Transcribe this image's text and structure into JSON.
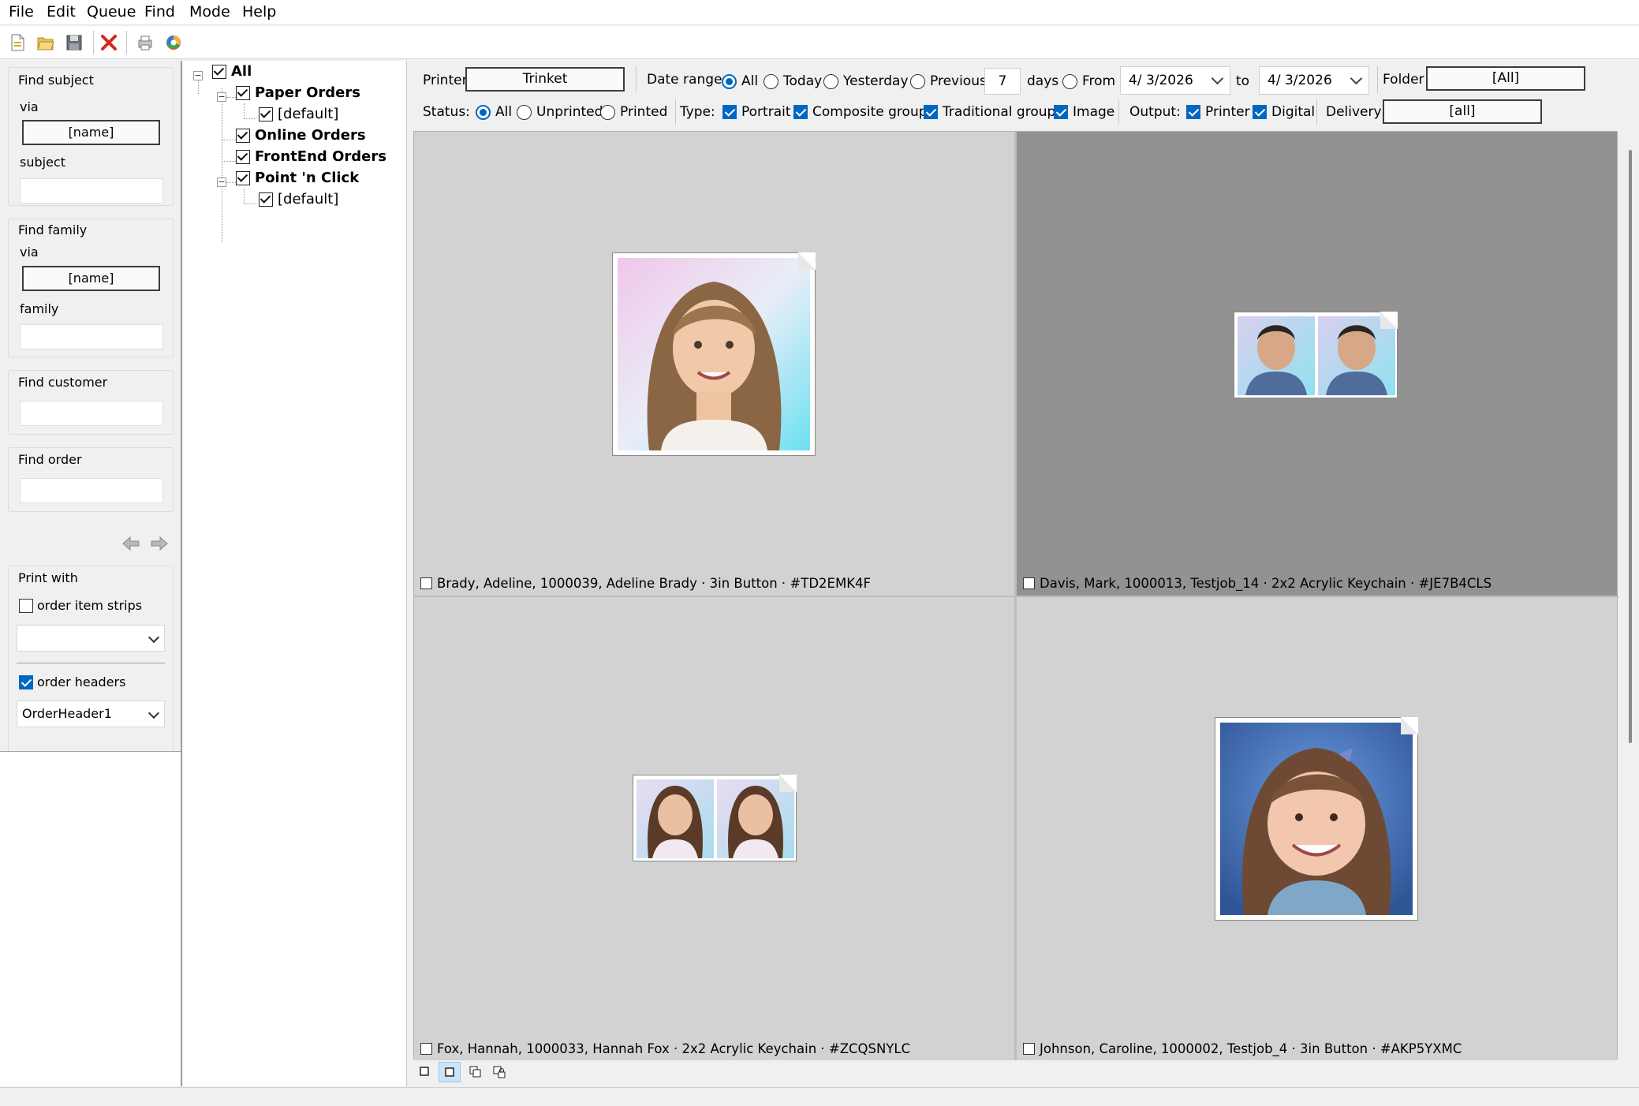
{
  "menu": {
    "file": "File",
    "edit": "Edit",
    "queue": "Queue",
    "find": "Find",
    "mode": "Mode",
    "help": "Help"
  },
  "toolbar_icons": [
    "new-icon",
    "open-folder-icon",
    "save-icon",
    "delete-icon",
    "print-icon",
    "color-icon"
  ],
  "left": {
    "find_subject": {
      "title": "Find subject",
      "via_label": "via",
      "via_value": "[name]",
      "field_label": "subject",
      "field_value": ""
    },
    "find_family": {
      "title": "Find family",
      "via_label": "via",
      "via_value": "[name]",
      "field_label": "family",
      "field_value": ""
    },
    "find_customer": {
      "title": "Find customer",
      "value": ""
    },
    "find_order": {
      "title": "Find order",
      "value": ""
    },
    "print_with": {
      "title": "Print with",
      "strips_label": "order item strips",
      "strips_checked": false,
      "strips_select": "",
      "headers_label": "order headers",
      "headers_checked": true,
      "headers_select": "OrderHeader1"
    }
  },
  "tree": {
    "all": "All",
    "paper": "Paper Orders",
    "paper_default": "[default]",
    "online": "Online Orders",
    "frontend": "FrontEnd Orders",
    "pointclick": "Point 'n Click",
    "pointclick_default": "[default]"
  },
  "filters": {
    "printer_label": "Printer",
    "printer_value": "Trinket",
    "date_range_label": "Date range:",
    "opt_all": "All",
    "opt_today": "Today",
    "opt_yesterday": "Yesterday",
    "opt_previous": "Previous",
    "days_value": "7",
    "days_label": "days",
    "opt_from": "From",
    "date_from": "4/ 3/2026",
    "to_label": "to",
    "date_to": "4/ 3/2026",
    "folder_label": "Folder",
    "folder_value": "[All]",
    "status_label": "Status:",
    "status_all": "All",
    "status_unprinted": "Unprinted",
    "status_printed": "Printed",
    "type_label": "Type:",
    "type_portrait": "Portrait",
    "type_composite": "Composite groups",
    "type_traditional": "Traditional groups",
    "type_image": "Image",
    "output_label": "Output:",
    "output_printer": "Printer",
    "output_digital": "Digital",
    "delivery_label": "Delivery",
    "delivery_value": "[all]"
  },
  "items": [
    {
      "caption": "Brady, Adeline, 1000039, Adeline Brady · 3in Button · #TD2EMK4F"
    },
    {
      "caption": "Davis, Mark, 1000013, Testjob_14 · 2x2 Acrylic Keychain · #JE7B4CLS"
    },
    {
      "caption": "Fox, Hannah, 1000033, Hannah Fox · 2x2 Acrylic Keychain · #ZCQSNYLC"
    },
    {
      "caption": "Johnson, Caroline, 1000002, Testjob_4 · 3in Button · #AKP5YXMC"
    }
  ],
  "colors": {
    "accent": "#0067c0",
    "selected_cell": "#929292",
    "cell": "#d2d2d2"
  }
}
